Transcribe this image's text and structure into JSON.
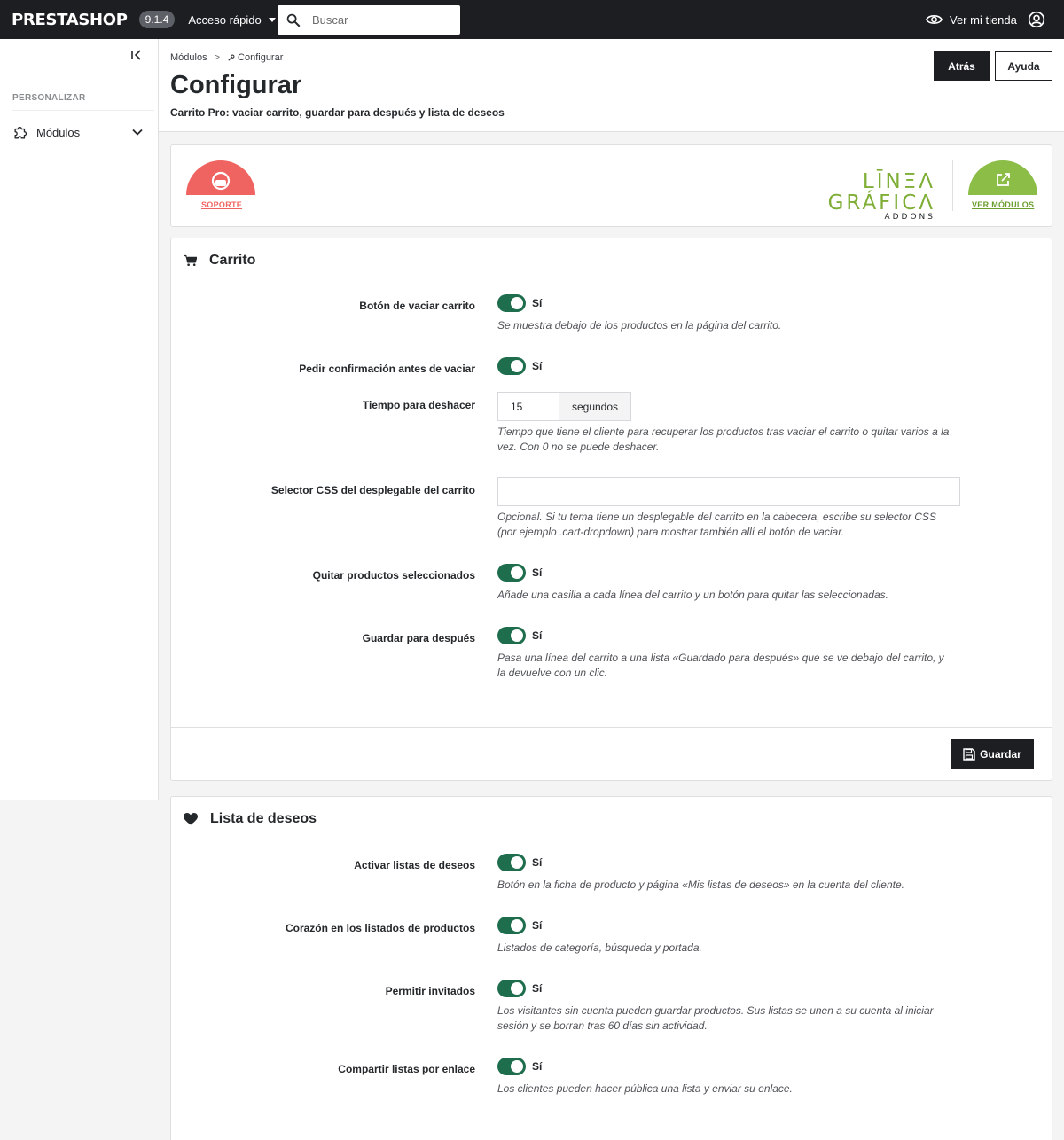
{
  "topbar": {
    "brand": "PRESTASHOP",
    "version": "9.1.4",
    "quick_access": "Acceso rápido",
    "search_placeholder": "Buscar",
    "view_shop": "Ver mi tienda"
  },
  "sidebar": {
    "section_title": "PERSONALIZAR",
    "items": [
      {
        "label": "Módulos"
      }
    ]
  },
  "header": {
    "breadcrumb": [
      "Módulos",
      "Configurar"
    ],
    "breadcrumb_separator": ">",
    "title": "Configurar",
    "subtitle": "Carrito Pro: vaciar carrito, guardar para después y lista de deseos",
    "back_button": "Atrás",
    "help_button": "Ayuda"
  },
  "banner": {
    "support_label": "SOPORTE",
    "support_color": "#ef6461",
    "logo_main": "LĪNΞΛ GRÁFICΛ",
    "logo_sub": "ADDONS",
    "logo_color": "#7fae36",
    "modules_label": "VER MÓDULOS",
    "modules_color": "#8bbd47"
  },
  "cart_section": {
    "title": "Carrito",
    "fields": [
      {
        "label": "Botón de vaciar carrito",
        "value": "Sí",
        "help": "Se muestra debajo de los productos en la página del carrito."
      },
      {
        "label": "Pedir confirmación antes de vaciar",
        "value": "Sí"
      },
      {
        "label": "Tiempo para deshacer",
        "value": "15",
        "unit": "segundos",
        "help": "Tiempo que tiene el cliente para recuperar los productos tras vaciar el carrito o quitar varios a la vez. Con 0 no se puede deshacer."
      },
      {
        "label": "Selector CSS del desplegable del carrito",
        "value": "",
        "help": "Opcional. Si tu tema tiene un desplegable del carrito en la cabecera, escribe su selector CSS (por ejemplo .cart-dropdown) para mostrar también allí el botón de vaciar."
      },
      {
        "label": "Quitar productos seleccionados",
        "value": "Sí",
        "help": "Añade una casilla a cada línea del carrito y un botón para quitar las seleccionadas."
      },
      {
        "label": "Guardar para después",
        "value": "Sí",
        "help": "Pasa una línea del carrito a una lista «Guardado para después» que se ve debajo del carrito, y la devuelve con un clic."
      }
    ],
    "save_button": "Guardar"
  },
  "wishlist_section": {
    "title": "Lista de deseos",
    "fields": [
      {
        "label": "Activar listas de deseos",
        "value": "Sí",
        "help": "Botón en la ficha de producto y página «Mis listas de deseos» en la cuenta del cliente."
      },
      {
        "label": "Corazón en los listados de productos",
        "value": "Sí",
        "help": "Listados de categoría, búsqueda y portada."
      },
      {
        "label": "Permitir invitados",
        "value": "Sí",
        "help": "Los visitantes sin cuenta pueden guardar productos. Sus listas se unen a su cuenta al iniciar sesión y se borran tras 60 días sin actividad."
      },
      {
        "label": "Compartir listas por enlace",
        "value": "Sí",
        "help": "Los clientes pueden hacer pública una lista y enviar su enlace."
      }
    ]
  },
  "colors": {
    "topbar_bg": "#1c1e21",
    "switch_on": "#1e6e4e",
    "primary_button": "#1c1e21"
  }
}
